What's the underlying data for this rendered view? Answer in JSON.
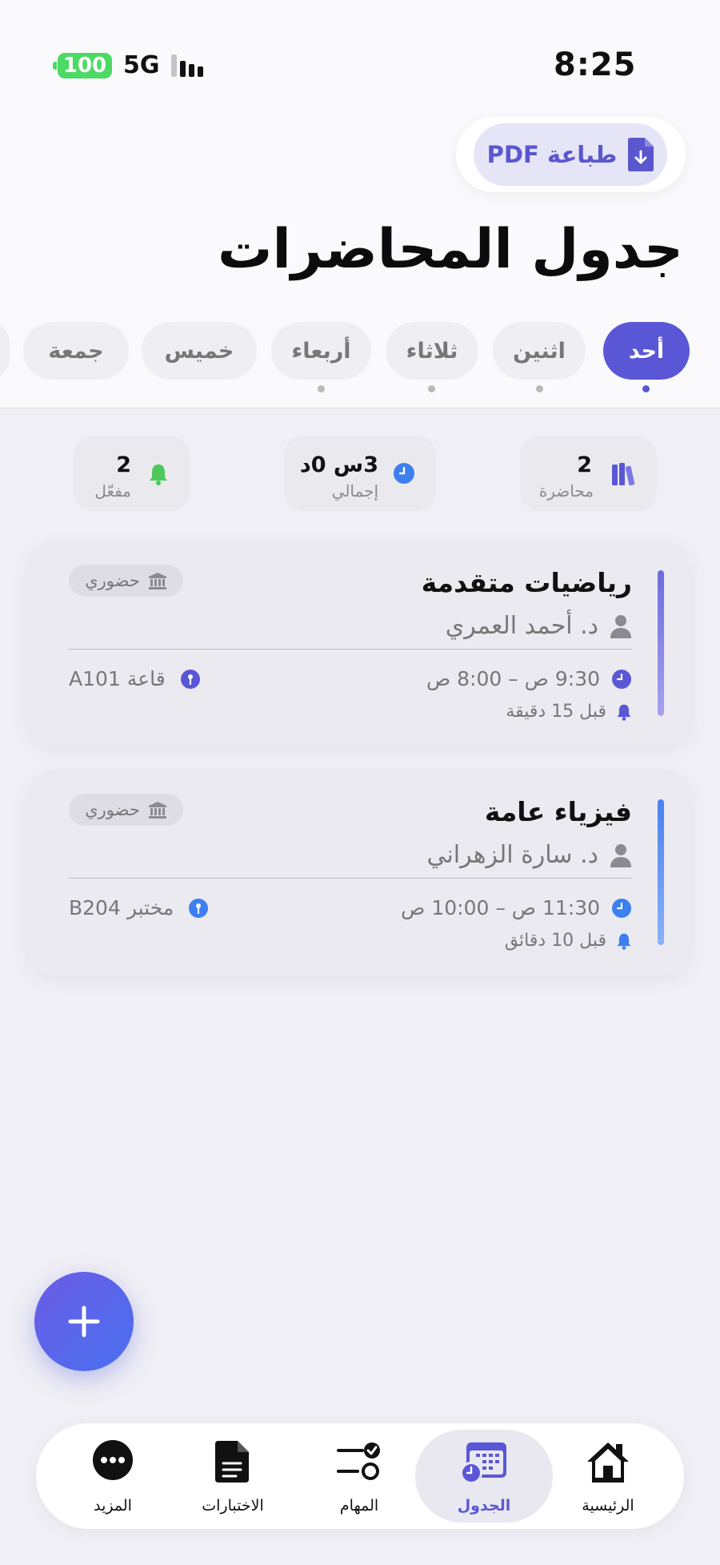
{
  "status_bar": {
    "time": "8:25",
    "network": "5G",
    "battery": "100"
  },
  "header": {
    "print_label": "طباعة PDF",
    "title": "جدول المحاضرات"
  },
  "days": [
    {
      "label": "أحد",
      "active": true,
      "has_dot": true
    },
    {
      "label": "اثنين",
      "active": false,
      "has_dot": true
    },
    {
      "label": "ثلاثاء",
      "active": false,
      "has_dot": true
    },
    {
      "label": "أربعاء",
      "active": false,
      "has_dot": true
    },
    {
      "label": "خميس",
      "active": false,
      "has_dot": false
    },
    {
      "label": "جمعة",
      "active": false,
      "has_dot": false
    }
  ],
  "stats": {
    "lectures": {
      "value": "2",
      "label": "محاضرة"
    },
    "total": {
      "value": "3س 0د",
      "label": "إجمالي"
    },
    "enabled": {
      "value": "2",
      "label": "مفعّل"
    }
  },
  "lectures": [
    {
      "title": "رياضيات متقدمة",
      "instructor": "د. أحمد العمري",
      "mode": "حضوري",
      "time": "9:30 ص – 8:00 ص",
      "location": "قاعة A101",
      "reminder": "قبل 15 دقيقة",
      "color": "#7b76e0"
    },
    {
      "title": "فيزياء عامة",
      "instructor": "د. سارة الزهراني",
      "mode": "حضوري",
      "time": "11:30 ص – 10:00 ص",
      "location": "مختبر B204",
      "reminder": "قبل 10 دقائق",
      "color": "#5b8ff0"
    }
  ],
  "nav": {
    "home": "الرئيسية",
    "schedule": "الجدول",
    "tasks": "المهام",
    "exams": "الاختبارات",
    "more": "المزيد"
  },
  "colors": {
    "accent": "#5a57d6",
    "blue": "#3d7ff0",
    "green": "#4cd964"
  }
}
